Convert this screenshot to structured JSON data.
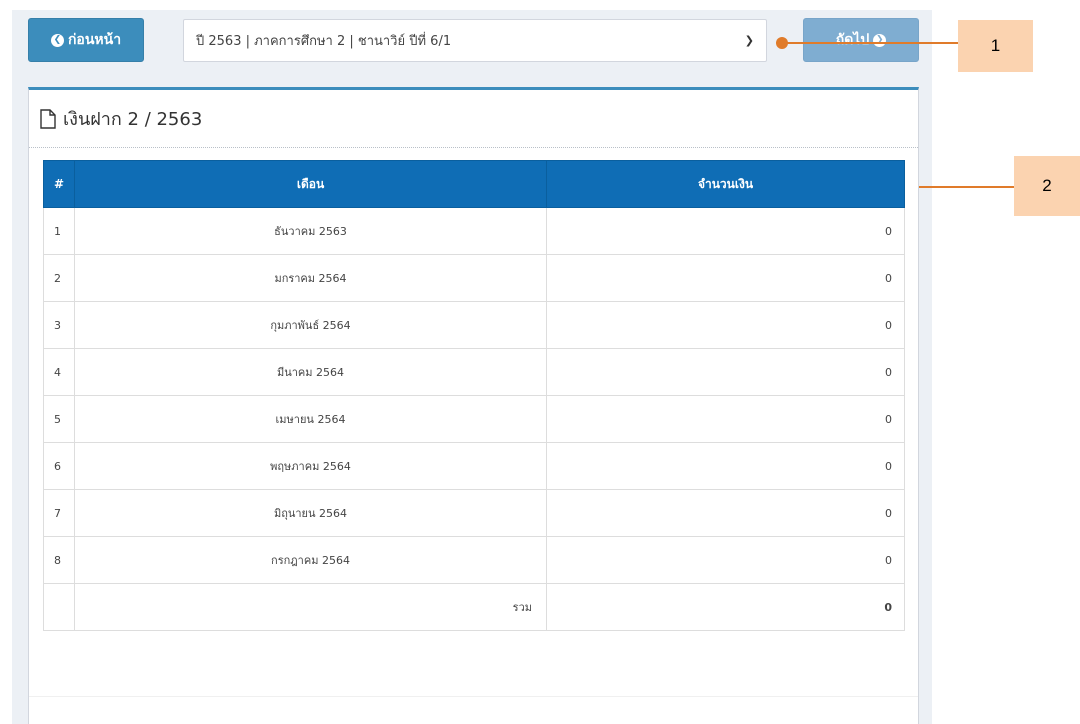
{
  "nav": {
    "prev_label": "ก่อนหน้า",
    "next_label": "ถัดไป",
    "select_value": "ปี 2563 | ภาคการศึกษา 2 | ชานาวิย์ ปีที่ 6/1"
  },
  "callouts": [
    "1",
    "2"
  ],
  "box": {
    "title": "เงินฝาก 2 / 2563"
  },
  "table": {
    "headers": [
      "#",
      "เดือน",
      "จำนวนเงิน"
    ],
    "rows": [
      {
        "no": "1",
        "month": "ธันวาคม 2563",
        "amount": "0"
      },
      {
        "no": "2",
        "month": "มกราคม 2564",
        "amount": "0"
      },
      {
        "no": "3",
        "month": "กุมภาพันธ์ 2564",
        "amount": "0"
      },
      {
        "no": "4",
        "month": "มีนาคม 2564",
        "amount": "0"
      },
      {
        "no": "5",
        "month": "เมษายน 2564",
        "amount": "0"
      },
      {
        "no": "6",
        "month": "พฤษภาคม 2564",
        "amount": "0"
      },
      {
        "no": "7",
        "month": "มิถุนายน 2564",
        "amount": "0"
      },
      {
        "no": "8",
        "month": "กรกฎาคม 2564",
        "amount": "0"
      }
    ],
    "total_label": "รวม",
    "total_amount": "0"
  },
  "colors": {
    "primary": "#3c8dbc",
    "table_header": "#0f6db5",
    "callout": "#e07b2a",
    "callout_box": "#fbd3b0"
  }
}
